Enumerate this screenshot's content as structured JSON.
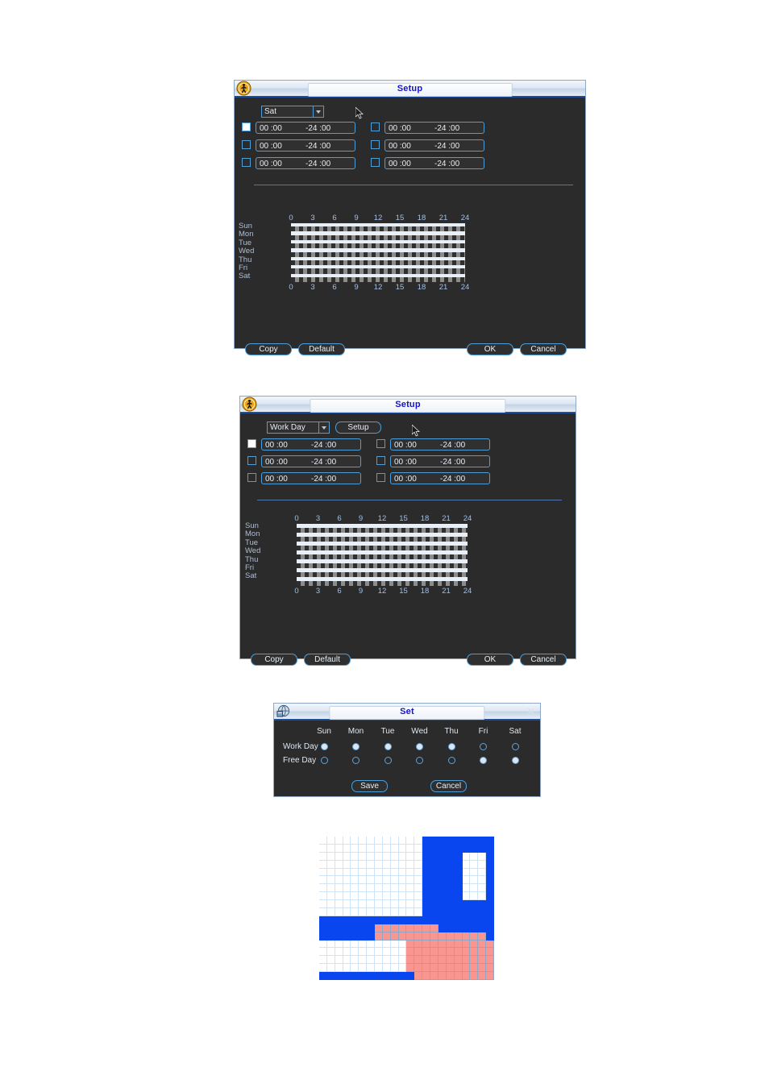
{
  "page": {
    "background": "#ffffff"
  },
  "dialog1": {
    "title": "Setup",
    "icon": "person-walking-icon",
    "day_select": {
      "value": "Sat",
      "options": [
        "Sun",
        "Mon",
        "Tue",
        "Wed",
        "Thu",
        "Fri",
        "Sat"
      ]
    },
    "periods": [
      {
        "enabled": true,
        "start": "00 :00",
        "end": "-24 :00"
      },
      {
        "enabled": false,
        "start": "00 :00",
        "end": "-24 :00"
      },
      {
        "enabled": false,
        "start": "00 :00",
        "end": "-24 :00"
      },
      {
        "enabled": false,
        "start": "00 :00",
        "end": "-24 :00"
      },
      {
        "enabled": false,
        "start": "00 :00",
        "end": "-24 :00"
      },
      {
        "enabled": false,
        "start": "00 :00",
        "end": "-24 :00"
      }
    ],
    "schedule": {
      "days": [
        "Sun",
        "Mon",
        "Tue",
        "Wed",
        "Thu",
        "Fri",
        "Sat"
      ],
      "hour_ticks": [
        "0",
        "3",
        "6",
        "9",
        "12",
        "15",
        "18",
        "21",
        "24"
      ]
    },
    "buttons": {
      "copy": "Copy",
      "default": "Default",
      "ok": "OK",
      "cancel": "Cancel"
    }
  },
  "dialog2": {
    "title": "Setup",
    "icon": "person-walking-icon",
    "day_select": {
      "value": "Work Day",
      "options": [
        "Work Day",
        "Free Day"
      ]
    },
    "setup_button": "Setup",
    "periods": [
      {
        "enabled": true,
        "start": "00 :00",
        "end": "-24 :00"
      },
      {
        "enabled": false,
        "start": "00 :00",
        "end": "-24 :00"
      },
      {
        "enabled": false,
        "start": "00 :00",
        "end": "-24 :00"
      },
      {
        "enabled": false,
        "start": "00 :00",
        "end": "-24 :00"
      },
      {
        "enabled": false,
        "start": "00 :00",
        "end": "-24 :00"
      },
      {
        "enabled": false,
        "start": "00 :00",
        "end": "-24 :00"
      }
    ],
    "schedule": {
      "days": [
        "Sun",
        "Mon",
        "Tue",
        "Wed",
        "Thu",
        "Fri",
        "Sat"
      ],
      "hour_ticks": [
        "0",
        "3",
        "6",
        "9",
        "12",
        "15",
        "18",
        "21",
        "24"
      ]
    },
    "buttons": {
      "copy": "Copy",
      "default": "Default",
      "ok": "OK",
      "cancel": "Cancel"
    }
  },
  "dialog3": {
    "title": "Set",
    "icon": "calendar-globe-icon",
    "close_icon": "close-icon",
    "columns": [
      "Sun",
      "Mon",
      "Tue",
      "Wed",
      "Thu",
      "Fri",
      "Sat"
    ],
    "rows": [
      {
        "label": "Work Day",
        "selected": [
          true,
          true,
          true,
          true,
          true,
          false,
          false
        ]
      },
      {
        "label": "Free Day",
        "selected": [
          false,
          false,
          false,
          false,
          false,
          true,
          true
        ]
      }
    ],
    "buttons": {
      "save": "Save",
      "cancel": "Cancel"
    }
  },
  "region_grid": {
    "name": "motion-detection-region-grid",
    "cols": 22,
    "rows": 18,
    "colors": {
      "white": "#ffffff",
      "blue": "#0a46f0",
      "pink": "#f9968f",
      "gridline": "#cfe4f7"
    },
    "legend": {
      "white": "not-selected",
      "blue": "selected-zone",
      "pink": "highlighted-zone"
    },
    "cells": [
      "wwwwwwwwwwwwwbbbbbbbbb",
      "wwwwwwwwwwwwwbbbbbbbbb",
      "wwwwwwwwwwwwwbbbbbwwwb",
      "wwwwwwwwwwwwwbbbbbwwwb",
      "wwwwwwwwwwwwwbbbbbwwwb",
      "wwwwwwwwwwwwwbbbbbwwwb",
      "wwwwwwwwwwwwwbbbbbwwwb",
      "wwwwwwwwwwwwwbbbbbwwwb",
      "wwwwwwwwwwwwwbbbbbbbbb",
      "wwwwwwwwwwwwwbbbbbbbbb",
      "bbbbbbbbbbbbbbbbbbbbbb",
      "bbbbbbbppppppppbbbbbbb",
      "bbbbbbbppppppppppppppb",
      "wwwwwwwwwwwppppppppppp",
      "wwwwwwwwwwwppppppppppp",
      "wwwwwwwwwwwppppppppppp",
      "wwwwwwwwwwwppppppppppp",
      "bbbbbbbbbbbbpppppppppp"
    ]
  }
}
